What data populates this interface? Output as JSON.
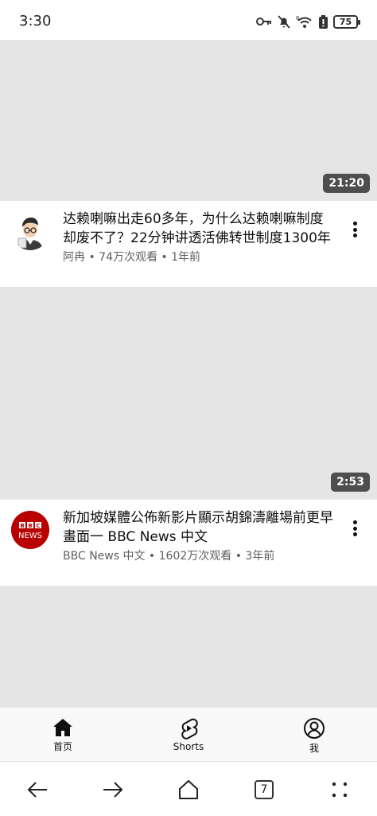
{
  "status_bar": {
    "time": "3:30",
    "battery": "75",
    "icons": [
      "key-icon",
      "bell-off-icon",
      "wifi-6-icon",
      "battery-alert-icon",
      "battery-icon"
    ]
  },
  "feed": [
    {
      "duration": "21:20",
      "title": "达赖喇嘛出走60多年，为什么达赖喇嘛制度却废不了？22分钟讲透活佛转世制度1300年",
      "meta": "阿冉 • 74万次观看 • 1年前",
      "avatar": "cartoon-man-avatar"
    },
    {
      "duration": "2:53",
      "title": "新加坡媒體公佈新影片顯示胡錦濤離場前更早畫面一 BBC News 中文",
      "meta": "BBC News 中文 • 1602万次观看 • 3年前",
      "avatar": "bbc-news-avatar",
      "avatar_text": "BBC NEWS"
    }
  ],
  "yt_nav": {
    "home": "首页",
    "shorts": "Shorts",
    "me": "我"
  },
  "browser": {
    "tab_count": "7"
  },
  "colors": {
    "thumbnail_placeholder": "#e5e5e5",
    "duration_badge": "#4e4e4e",
    "bbc_red": "#b80000",
    "meta_text": "#606060"
  }
}
